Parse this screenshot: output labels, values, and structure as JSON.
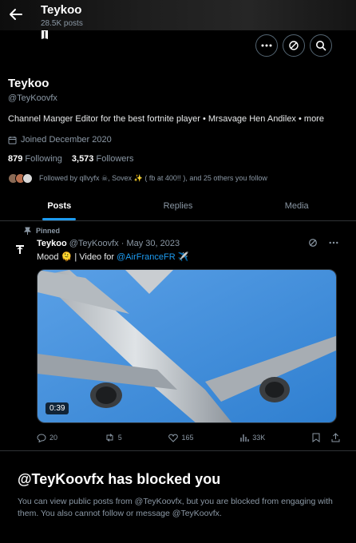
{
  "header": {
    "name": "Teykoo",
    "post_count": "28.5K posts"
  },
  "profile": {
    "name": "Teykoo",
    "handle": "@TeyKoovfx",
    "bio": "Channel Manger Editor for the best fortnite player • Mrsavage Hen Andilex • ",
    "bio_more": "more",
    "joined": "Joined December 2020",
    "following_count": "879",
    "following_label": "Following",
    "followers_count": "3,573",
    "followers_label": "Followers",
    "followed_by": "Followed by qllvyfx ☠, Sovex ✨ ( fb at 400!! ), and 25 others you follow"
  },
  "tabs": [
    {
      "label": "Posts",
      "active": true
    },
    {
      "label": "Replies",
      "active": false
    },
    {
      "label": "Media",
      "active": false
    }
  ],
  "tweet": {
    "pinned_label": "Pinned",
    "author": "Teykoo",
    "handle_date": "@TeyKoovfx · May 30, 2023",
    "text_prefix": "Mood 🫠 | Video for ",
    "mention": "@AirFranceFR",
    "text_suffix": " ✈️",
    "video_duration": "0:39",
    "replies": "20",
    "reposts": "5",
    "likes": "165",
    "views": "33K"
  },
  "blocked": {
    "title": "@TeyKoovfx has blocked you",
    "body": "You can view public posts from @TeyKoovfx, but you are blocked from engaging with them. You also cannot follow or message @TeyKoovfx."
  },
  "colors": {
    "accent": "#1d9bf0",
    "muted": "#8b98a5",
    "background": "#000000"
  }
}
